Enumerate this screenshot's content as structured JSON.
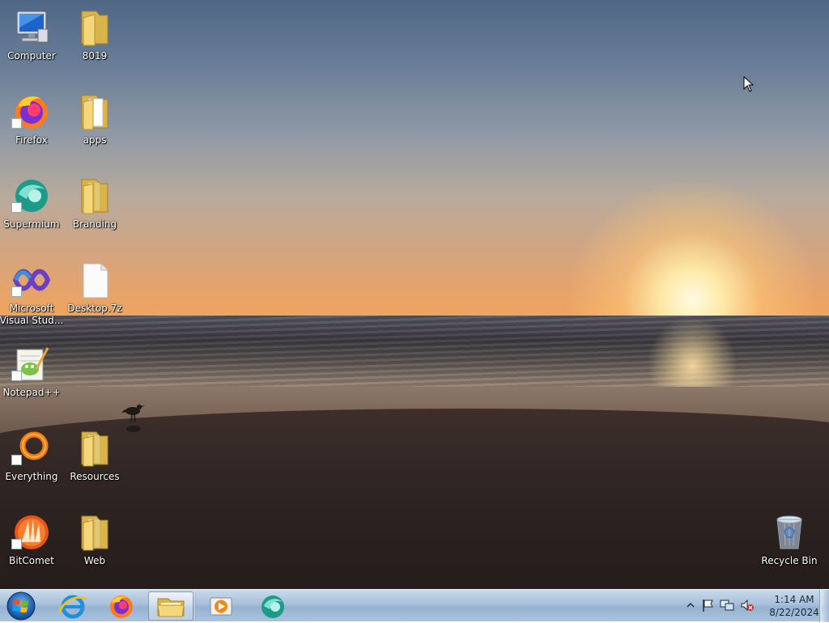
{
  "desktop": {
    "icons": [
      {
        "label": "Computer",
        "icon": "computer-icon"
      },
      {
        "label": "8019",
        "icon": "folder-icon"
      },
      {
        "label": "Firefox",
        "icon": "firefox-icon"
      },
      {
        "label": "apps",
        "icon": "folder-icon"
      },
      {
        "label": "Supermium",
        "icon": "supermium-icon"
      },
      {
        "label": "Branding",
        "icon": "folder-icon"
      },
      {
        "label": "Microsoft Visual Stud...",
        "icon": "visual-studio-icon"
      },
      {
        "label": "Desktop.7z",
        "icon": "archive-file-icon"
      },
      {
        "label": "Notepad++",
        "icon": "notepadpp-icon"
      },
      {
        "label": "Everything",
        "icon": "everything-icon"
      },
      {
        "label": "Resources",
        "icon": "folder-icon"
      },
      {
        "label": "BitComet",
        "icon": "bitcomet-icon"
      },
      {
        "label": "Web",
        "icon": "folder-icon"
      },
      {
        "label": "Recycle Bin",
        "icon": "recycle-bin-icon"
      }
    ]
  },
  "taskbar": {
    "start": "windows-start-orb-icon",
    "pinned": [
      "internet-explorer-icon",
      "firefox-icon",
      "file-explorer-icon",
      "media-player-icon",
      "supermium-icon"
    ],
    "tray_icons": [
      "show-hidden-icons-chevron",
      "action-center-flag-icon",
      "network-icon",
      "volume-muted-icon"
    ],
    "clock": {
      "time": "1:14 AM",
      "date": "8/22/2024"
    }
  },
  "colors": {
    "taskbar": "#a8c0da",
    "folder": "#e8c766",
    "label_text": "#ffffff"
  }
}
